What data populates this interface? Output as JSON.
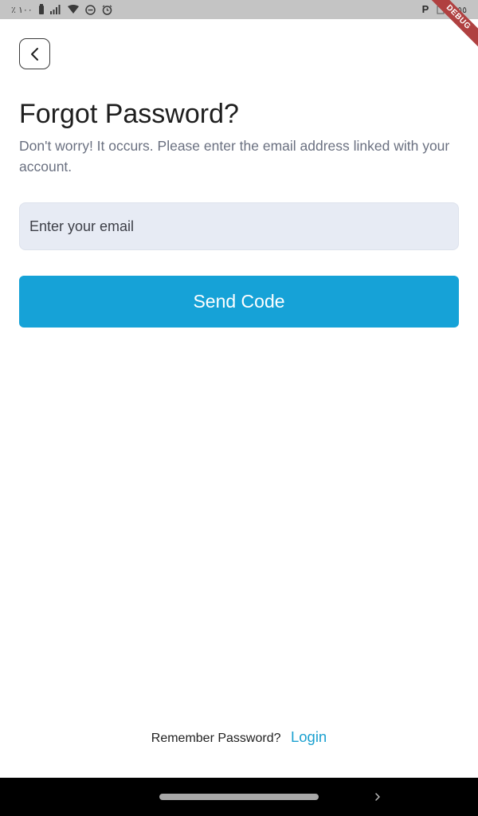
{
  "status_bar": {
    "left_text": "٪ ١٠٠",
    "right_text": "٠٥٥",
    "icons": [
      "battery-icon",
      "signal-icon",
      "wifi-icon",
      "do-not-disturb-icon",
      "alarm-icon",
      "parking-icon",
      "notification-icon"
    ]
  },
  "debug_banner": "DEBUG",
  "header": {
    "back_icon": "chevron-left-icon"
  },
  "main": {
    "title": "Forgot Password?",
    "subtitle": "Don't worry! It occurs. Please enter the email address linked with your account.",
    "email": {
      "value": "",
      "placeholder": "Enter your email"
    },
    "send_button_label": "Send Code"
  },
  "footer": {
    "prompt": "Remember Password?",
    "login_label": "Login"
  },
  "colors": {
    "accent": "#16a2d7",
    "link": "#1ca1d0",
    "field_background": "#e7ebf4",
    "subtitle_text": "#6a7080",
    "debug_ribbon": "#b04040"
  }
}
